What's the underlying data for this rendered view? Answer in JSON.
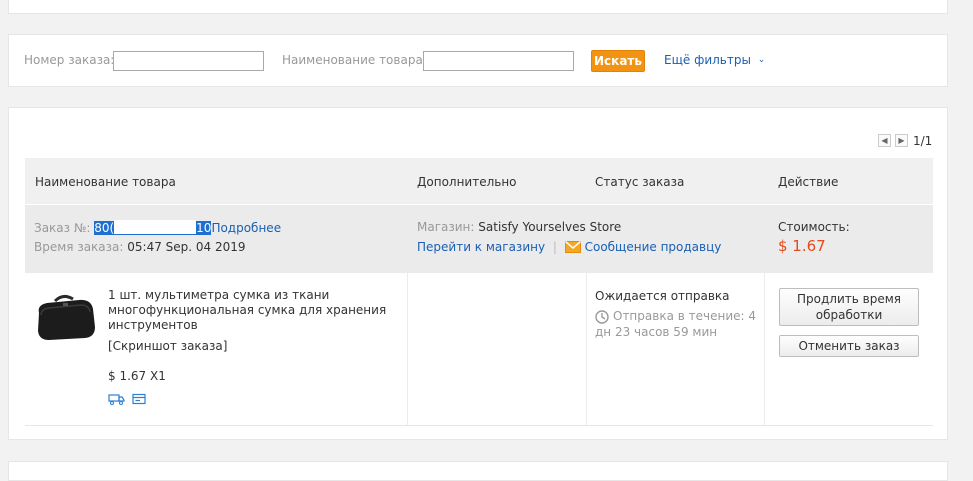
{
  "filters": {
    "order_number_label": "Номер заказа:",
    "order_number_value": "",
    "product_name_label": "Наименование товара:",
    "product_name_value": "",
    "search_label": "Искать",
    "more_filters_label": "Ещё фильтры"
  },
  "pagination": {
    "text": "1/1"
  },
  "table": {
    "headers": {
      "product": "Наименование товара",
      "additional": "Дополнительно",
      "status": "Статус заказа",
      "action": "Действие"
    }
  },
  "order": {
    "number_label": "Заказ №:",
    "number_prefix": "80(",
    "number_suffix": "10",
    "details_link": "Подробнее",
    "time_label": "Время заказа:",
    "time_value": "05:47 Sep. 04 2019",
    "store_label": "Магазин:",
    "store_name": "Satisfy Yourselves Store",
    "go_to_store": "Перейти к магазину",
    "separator": "|",
    "message_seller": "Сообщение продавцу",
    "cost_label": "Стоимость:",
    "cost_value": "$ 1.67",
    "product_title": "1 шт. мультиметра сумка из ткани многофункциональная сумка для хранения инструментов",
    "screenshot_link": "[Скриншот заказа]",
    "price_qty": "$ 1.67 X1",
    "status": "Ожидается отправка",
    "shipping_time": "Отправка в течение: 4 дн 23 часов 59 мин",
    "extend_button": "Продлить время обработки",
    "cancel_button": "Отменить заказ"
  },
  "colors": {
    "accent_orange": "#f29411",
    "link_blue": "#1a5fb4",
    "price_red": "#e64a19"
  },
  "icons": [
    "chevron-down-icon",
    "prev-page-icon",
    "next-page-icon",
    "envelope-icon",
    "clock-icon",
    "truck-icon",
    "receipt-icon"
  ]
}
